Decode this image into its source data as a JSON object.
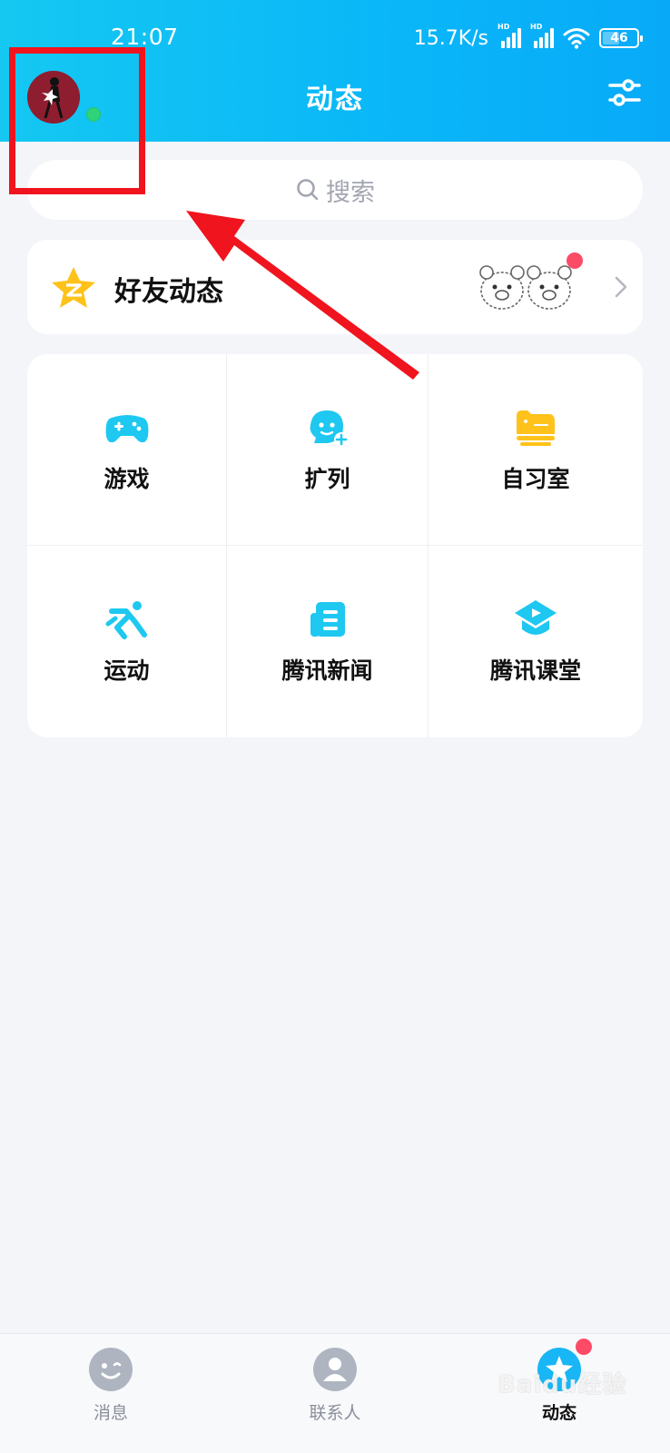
{
  "status_bar": {
    "time": "21:07",
    "net_speed": "15.7K/s",
    "signal_tag": "HD",
    "battery": "46",
    "icons": [
      "signal-hd-icon",
      "signal-hd-icon",
      "wifi-icon",
      "battery-icon"
    ]
  },
  "header": {
    "title": "动态",
    "avatar_online": true,
    "settings_icon": "sliders-icon"
  },
  "search": {
    "placeholder": "搜索",
    "icon": "search-icon"
  },
  "friends_feed": {
    "label": "好友动态",
    "icon": "qzone-star-icon",
    "has_new": true
  },
  "apps": [
    {
      "label": "游戏",
      "icon": "gamepad-icon"
    },
    {
      "label": "扩列",
      "icon": "add-friend-icon"
    },
    {
      "label": "自习室",
      "icon": "study-room-icon"
    },
    {
      "label": "运动",
      "icon": "running-icon"
    },
    {
      "label": "腾讯新闻",
      "icon": "news-icon"
    },
    {
      "label": "腾讯课堂",
      "icon": "classroom-icon"
    }
  ],
  "bottom_nav": [
    {
      "label": "消息",
      "icon": "message-icon",
      "active": false
    },
    {
      "label": "联系人",
      "icon": "contacts-icon",
      "active": false
    },
    {
      "label": "动态",
      "icon": "feed-icon",
      "active": true
    }
  ],
  "watermark": "Baidu经验",
  "colors": {
    "header_gradient_start": "#14c8f2",
    "header_gradient_end": "#08aaf8",
    "accent_cyan": "#1ec8f0",
    "accent_yellow": "#ffc21a",
    "badge_red": "#fb4b67",
    "online_green": "#2fd47a",
    "annotation_red": "#f0141e"
  }
}
